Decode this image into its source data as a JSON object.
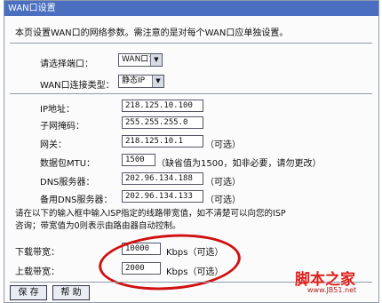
{
  "window": {
    "title": "WAN口设置"
  },
  "description": "本页设置WAN口的网络参数。需注意的是对每个WAN口应单独设置。",
  "port_select": {
    "label": "请选择端口：",
    "value": "WAN口1"
  },
  "connection_type": {
    "label": "WAN口连接类型：",
    "value": "静态IP"
  },
  "fields": [
    {
      "label": "IP地址：",
      "value": "218.125.10.100",
      "suffix": ""
    },
    {
      "label": "子网掩码：",
      "value": "255.255.255.0",
      "suffix": ""
    },
    {
      "label": "网关：",
      "value": "218.125.10.1",
      "suffix": "（可选）"
    },
    {
      "label": "数据包MTU：",
      "value": "1500",
      "suffix": "（缺省值为1500，如非必要，请勿更改）"
    },
    {
      "label": "DNS服务器：",
      "value": "202.96.134.188",
      "suffix": "（可选）"
    },
    {
      "label": "备用DNS服务器：",
      "value": "202.96.134.133",
      "suffix": "（可选）"
    }
  ],
  "bandwidth_help": [
    "请在以下的输入框中输入ISP指定的线路带宽值，如不清楚可以向您的ISP",
    "咨询；带宽值为0则表示由路由器自动控制。"
  ],
  "download": {
    "label": "下载带宽：",
    "value": "10000",
    "suffix": "Kbps（可选）"
  },
  "upload": {
    "label": "上载带宽：",
    "value": "2000",
    "suffix": "Kbps（可选）"
  },
  "buttons": {
    "save": "保 存",
    "help": "帮 助"
  },
  "watermark": {
    "logo": "脚本之家",
    "url": "www.JB51.net"
  },
  "colors": {
    "title_bar": "#4a6fc0",
    "annotation": "#d01010"
  }
}
